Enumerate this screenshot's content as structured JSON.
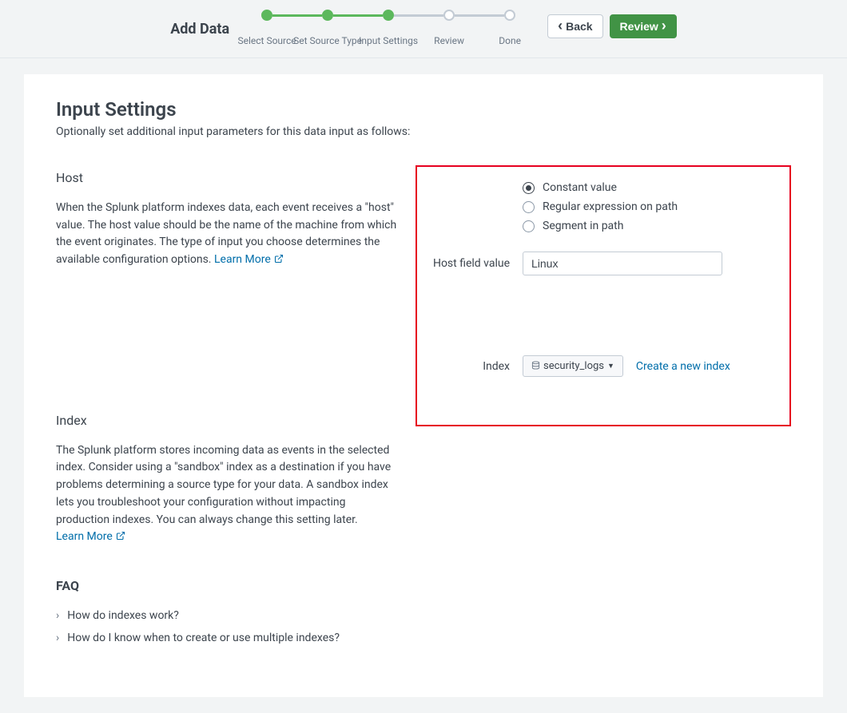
{
  "header": {
    "title": "Add Data",
    "steps": [
      {
        "label": "Select Source",
        "done": true
      },
      {
        "label": "Set Source Type",
        "done": true
      },
      {
        "label": "Input Settings",
        "done": true,
        "current": true
      },
      {
        "label": "Review",
        "done": false
      },
      {
        "label": "Done",
        "done": false
      }
    ],
    "back_label": "Back",
    "review_label": "Review"
  },
  "page": {
    "title": "Input Settings",
    "subtitle": "Optionally set additional input parameters for this data input as follows:"
  },
  "host": {
    "heading": "Host",
    "description": "When the Splunk platform indexes data, each event receives a \"host\" value. The host value should be the name of the machine from which the event originates. The type of input you choose determines the available configuration options.",
    "learn_more": "Learn More",
    "radios": {
      "constant": "Constant value",
      "regex": "Regular expression on path",
      "segment": "Segment in path"
    },
    "field_label": "Host field value",
    "field_value": "Linux"
  },
  "index": {
    "heading": "Index",
    "description": "The Splunk platform stores incoming data as events in the selected index. Consider using a \"sandbox\" index as a destination if you have problems determining a source type for your data. A sandbox index lets you troubleshoot your configuration without impacting production indexes. You can always change this setting later.",
    "learn_more": "Learn More",
    "label": "Index",
    "selected": "security_logs",
    "create_link": "Create a new index"
  },
  "faq": {
    "heading": "FAQ",
    "items": [
      "How do indexes work?",
      "How do I know when to create or use multiple indexes?"
    ]
  }
}
